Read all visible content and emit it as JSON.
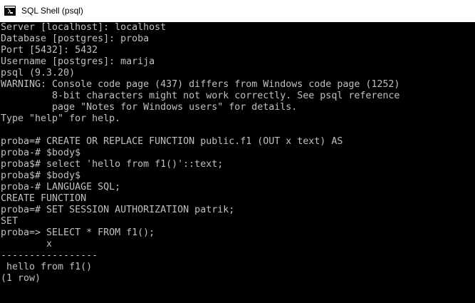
{
  "window": {
    "title": "SQL Shell (psql)",
    "icon": "console-icon"
  },
  "colors": {
    "console_background": "#000000",
    "console_text": "#c0c0c0",
    "titlebar_background": "#ffffff"
  },
  "console": {
    "lines": [
      "Server [localhost]: localhost",
      "Database [postgres]: proba",
      "Port [5432]: 5432",
      "Username [postgres]: marija",
      "psql (9.3.20)",
      "WARNING: Console code page (437) differs from Windows code page (1252)",
      "         8-bit characters might not work correctly. See psql reference",
      "         page \"Notes for Windows users\" for details.",
      "Type \"help\" for help.",
      "",
      "proba=# CREATE OR REPLACE FUNCTION public.f1 (OUT x text) AS",
      "proba-# $body$",
      "proba$# select 'hello from f1()'::text;",
      "proba$# $body$",
      "proba-# LANGUAGE SQL;",
      "CREATE FUNCTION",
      "proba=# SET SESSION AUTHORIZATION patrik;",
      "SET",
      "proba=> SELECT * FROM f1();",
      "        x",
      "-----------------",
      " hello from f1()",
      "(1 row)"
    ]
  }
}
